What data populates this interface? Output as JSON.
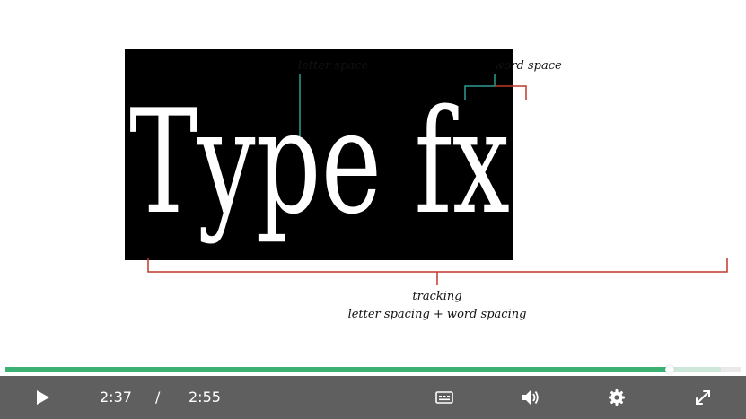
{
  "slide": {
    "headline": "Type fx",
    "labels": {
      "letter_space": "letter space",
      "word_space": "word space",
      "tracking": "tracking",
      "tracking_formula": "letter spacing + word spacing"
    },
    "colors": {
      "panel": "#000000",
      "headline": "#ffffff",
      "letter_marker": "#2a9d8f",
      "word_marker_green": "#2a9d8f",
      "word_marker_red": "#c0392b",
      "tracking_bracket": "#c0392b"
    }
  },
  "player": {
    "progress": {
      "played_fraction": 0.904,
      "buffered_fraction": 0.973
    },
    "current_time": "2:37",
    "separator": "/",
    "duration": "2:55",
    "icons": {
      "play": "play-icon",
      "captions": "captions-icon",
      "volume": "volume-icon",
      "settings": "gear-icon",
      "fullscreen": "fullscreen-icon"
    },
    "colors": {
      "bar": "#5f5f5f",
      "played": "#3bb273",
      "buffered": "#cde8d8",
      "icons": "#ffffff"
    }
  }
}
